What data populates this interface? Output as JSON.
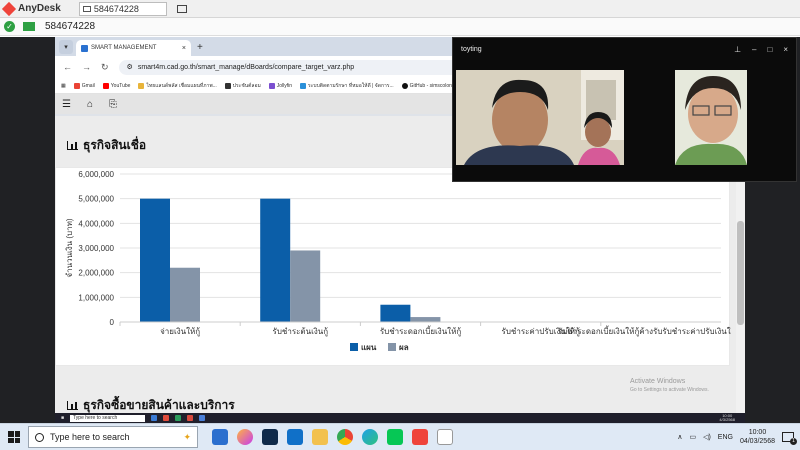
{
  "anydesk": {
    "app_name": "AnyDesk",
    "tab_id": "584674228",
    "session_id": "584674228"
  },
  "browser": {
    "tab_title": "SMART MANAGEMENT",
    "url": "smart4m.cad.go.th/smart_manage/dBoards/compare_target_varz.php",
    "bookmarks": [
      "Gmail",
      "YouTube",
      "ไทยแลนด์พลัส เชื่อมแผนที่ภาพ...",
      "ประชันต์ลอม",
      "Jollyfin",
      "ระบบติดตามรักษา ที่หมอให้ดี | จัดการ...",
      "GitHub - simscolony/TS..."
    ]
  },
  "page": {
    "section1_title": "ธุรกิจสินเชื่อ",
    "section2_title": "ธุรกิจซื้อขายสินค้าและบริการ",
    "watermark_title": "Activate Windows",
    "watermark_sub": "Go to Settings to activate Windows."
  },
  "chart_data": {
    "type": "bar",
    "ylabel": "จำนวนเงิน (บาท)",
    "xlabel": "",
    "categories": [
      "จ่ายเงินให้กู้",
      "รับชำระต้นเงินกู้",
      "รับชำระดอกเบี้ยเงินให้กู้",
      "รับชำระค่าปรับเงินให้กู้",
      "รับชำระดอกเบี้ยเงินให้กู้ค้างรับรับชำระค่าปรับเงินให้กู้ค้างรับ"
    ],
    "series": [
      {
        "name": "แผน",
        "color": "#0b5ea8",
        "values": [
          5000000,
          5000000,
          700000,
          0,
          0
        ]
      },
      {
        "name": "ผล",
        "color": "#8494a8",
        "values": [
          2200000,
          2900000,
          200000,
          0,
          20000
        ]
      }
    ],
    "ylim": [
      0,
      6000000
    ],
    "yticks": [
      "0",
      "1,000,000",
      "2,000,000",
      "3,000,000",
      "4,000,000",
      "5,000,000",
      "6,000,000"
    ],
    "grid": true,
    "legend_position": "bottom"
  },
  "video_call": {
    "caller_name": "toyting"
  },
  "remote_taskbar": {
    "search_text": "Type here to search",
    "time": "10:00",
    "date": "4/3/2568"
  },
  "taskbar": {
    "search_placeholder": "Type here to search",
    "language": "ENG",
    "time": "10:00",
    "date": "04/03/2568",
    "notification_count": "1"
  }
}
